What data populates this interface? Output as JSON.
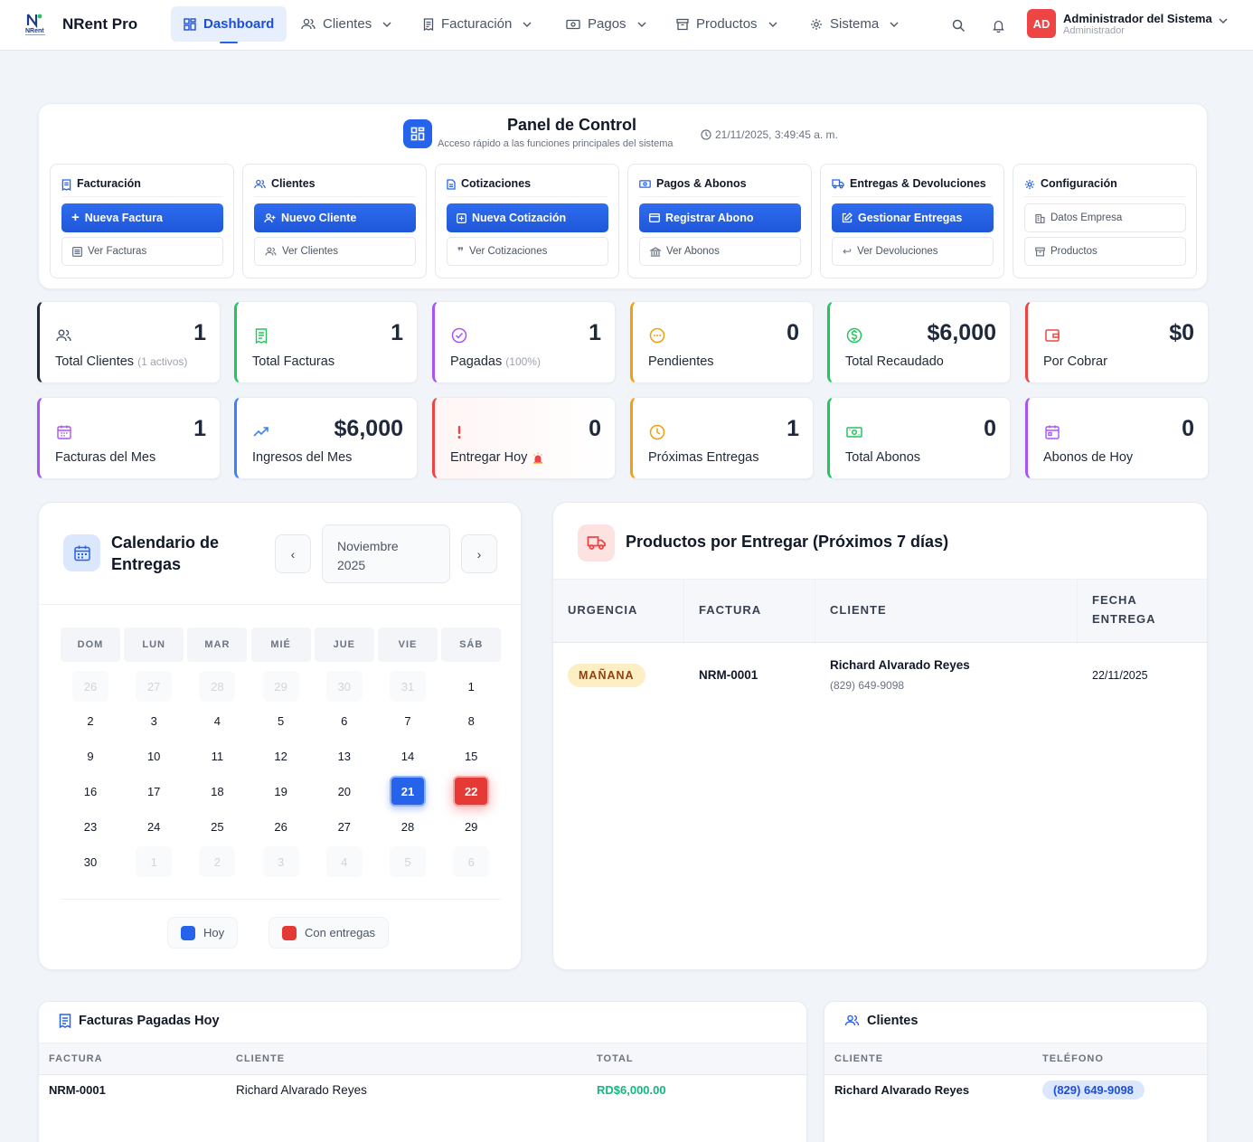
{
  "navbar": {
    "brand": "NRent Pro",
    "logo_text": "NRent",
    "items": [
      {
        "label": "Dashboard",
        "active": true
      },
      {
        "label": "Clientes"
      },
      {
        "label": "Facturación"
      },
      {
        "label": "Pagos"
      },
      {
        "label": "Productos"
      },
      {
        "label": "Sistema"
      }
    ],
    "user": {
      "initials": "AD",
      "name": "Administrador del Sistema",
      "role": "Administrador"
    }
  },
  "panel": {
    "title": "Panel de Control",
    "subtitle": "Acceso rápido a las funciones principales del sistema",
    "timestamp": "21/11/2025, 3:49:45 a. m.",
    "cards": [
      {
        "title": "Facturación",
        "primary": "Nueva Factura",
        "secondary": "Ver Facturas"
      },
      {
        "title": "Clientes",
        "primary": "Nuevo Cliente",
        "secondary": "Ver Clientes"
      },
      {
        "title": "Cotizaciones",
        "primary": "Nueva Cotización",
        "secondary": "Ver Cotizaciones"
      },
      {
        "title": "Pagos & Abonos",
        "primary": "Registrar Abono",
        "secondary": "Ver Abonos"
      },
      {
        "title": "Entregas & Devoluciones",
        "primary": "Gestionar Entregas",
        "secondary": "Ver Devoluciones"
      },
      {
        "title": "Configuración",
        "secondary_top": "Datos Empresa",
        "secondary": "Productos"
      }
    ]
  },
  "stats_row1": [
    {
      "value": "1",
      "label": "Total Clientes",
      "note": "(1 activos)",
      "color": "#1e293b"
    },
    {
      "value": "1",
      "label": "Total Facturas",
      "color": "#22c55e"
    },
    {
      "value": "1",
      "label": "Pagadas",
      "note": "(100%)",
      "color": "#a855f7"
    },
    {
      "value": "0",
      "label": "Pendientes",
      "color": "#f59e0b"
    },
    {
      "value": "$6,000",
      "label": "Total Recaudado",
      "color": "#22c55e"
    },
    {
      "value": "$0",
      "label": "Por Cobrar",
      "color": "#ef4444"
    }
  ],
  "stats_row2": [
    {
      "value": "1",
      "label": "Facturas del Mes",
      "color": "#a855f7"
    },
    {
      "value": "$6,000",
      "label": "Ingresos del Mes",
      "color": "#3b82f6"
    },
    {
      "value": "0",
      "label": "Entregar Hoy",
      "color": "#ef4444"
    },
    {
      "value": "1",
      "label": "Próximas Entregas",
      "color": "#f59e0b"
    },
    {
      "value": "0",
      "label": "Total Abonos",
      "color": "#22c55e"
    },
    {
      "value": "0",
      "label": "Abonos de Hoy",
      "color": "#a855f7"
    }
  ],
  "calendar": {
    "title": "Calendario de Entregas",
    "month": "Noviembre",
    "year": "2025",
    "prev": "‹",
    "next": "›",
    "weekdays": [
      "DOM",
      "LUN",
      "MAR",
      "MIÉ",
      "JUE",
      "VIE",
      "SÁB"
    ],
    "days": [
      [
        "26",
        "27",
        "28",
        "29",
        "30",
        "31",
        "1"
      ],
      [
        "2",
        "3",
        "4",
        "5",
        "6",
        "7",
        "8"
      ],
      [
        "9",
        "10",
        "11",
        "12",
        "13",
        "14",
        "15"
      ],
      [
        "16",
        "17",
        "18",
        "19",
        "20",
        "21",
        "22"
      ],
      [
        "23",
        "24",
        "25",
        "26",
        "27",
        "28",
        "29"
      ],
      [
        "30",
        "1",
        "2",
        "3",
        "4",
        "5",
        "6"
      ]
    ],
    "today": "21",
    "delivery_day": "22",
    "legend_today": "Hoy",
    "legend_deliveries": "Con entregas"
  },
  "deliveries": {
    "title": "Productos por Entregar (Próximos 7 días)",
    "headers": [
      "URGENCIA",
      "FACTURA",
      "CLIENTE",
      "FECHA",
      "ENTREGA"
    ],
    "row": {
      "urgency": "MAÑANA",
      "invoice": "NRM-0001",
      "client": "Richard Alvarado Reyes",
      "phone": "(829) 649-9098",
      "date": "22/11/2025"
    }
  },
  "paid_today": {
    "title": "Facturas Pagadas Hoy",
    "headers": [
      "FACTURA",
      "CLIENTE",
      "TOTAL"
    ],
    "row": {
      "invoice": "NRM-0001",
      "client": "Richard Alvarado Reyes",
      "total": "RD$6,000.00"
    }
  },
  "clients_table": {
    "title": "Clientes",
    "headers": [
      "CLIENTE",
      "TELÉFONO"
    ],
    "row": {
      "client": "Richard Alvarado Reyes",
      "phone": "(829) 649-9098"
    }
  },
  "colors": {
    "primary": "#2563eb",
    "danger": "#ef4444",
    "success": "#10b981"
  }
}
